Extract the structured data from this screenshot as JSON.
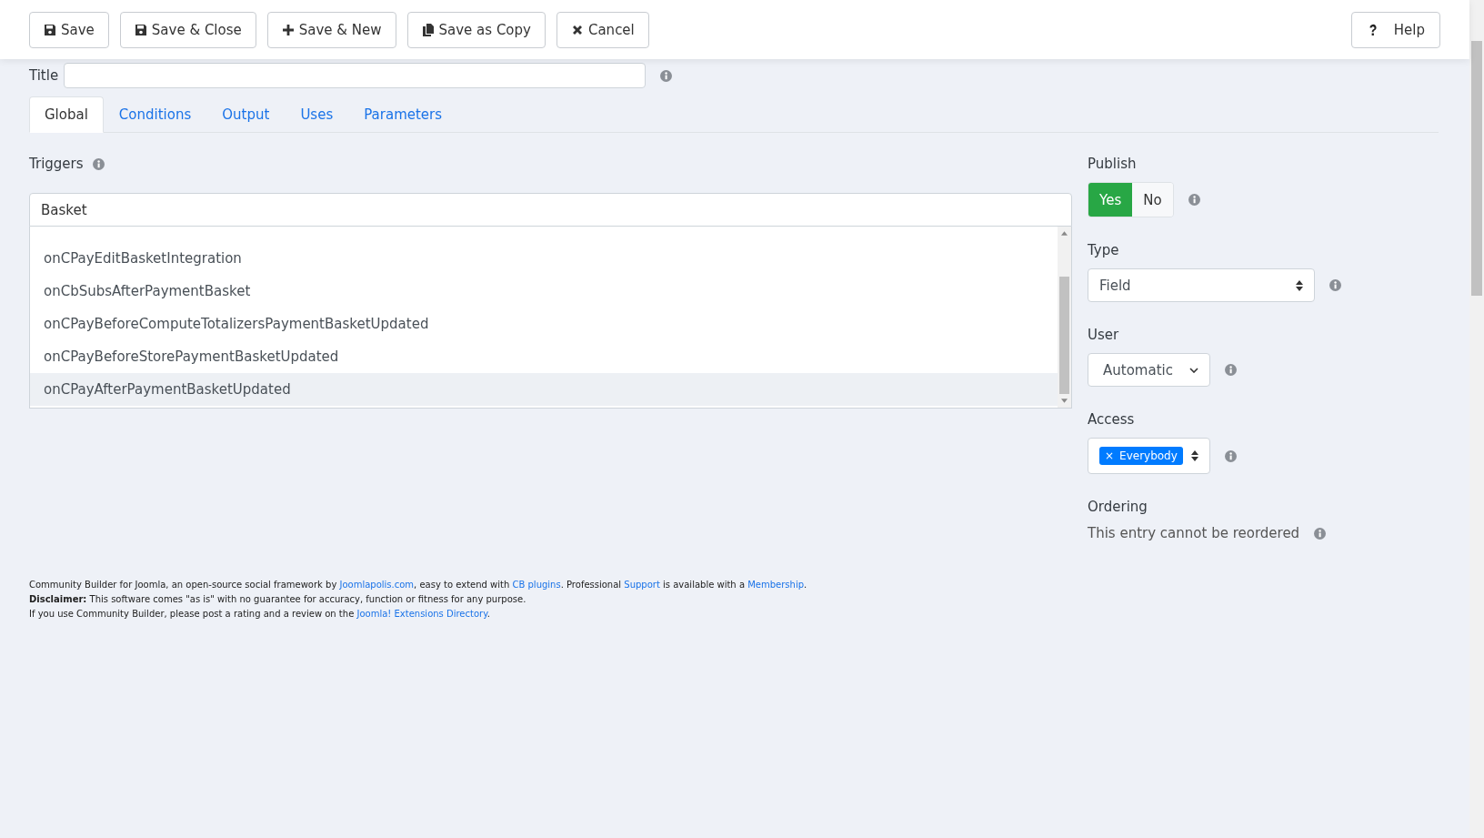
{
  "toolbar": {
    "buttons": [
      {
        "label": "Save"
      },
      {
        "label": "Save & Close"
      },
      {
        "label": "Save & New"
      },
      {
        "label": "Save as Copy"
      },
      {
        "label": "Cancel"
      }
    ],
    "help": {
      "label": "Help"
    }
  },
  "title_field": {
    "label": "Title"
  },
  "tabs": [
    {
      "label": "Global",
      "selected": true
    },
    {
      "label": "Conditions",
      "selected": false
    },
    {
      "label": "Output",
      "selected": false
    },
    {
      "label": "Uses",
      "selected": false
    },
    {
      "label": "Parameters",
      "selected": false
    }
  ],
  "triggers": {
    "label": "Triggers",
    "value": "Basket",
    "options": [
      {
        "label": "onCPayEditBasketIntegration",
        "highlighted": false
      },
      {
        "label": "onCbSubsAfterPaymentBasket",
        "highlighted": false
      },
      {
        "label": "onCPayBeforeComputeTotalizersPaymentBasketUpdated",
        "highlighted": false
      },
      {
        "label": "onCPayBeforeStorePaymentBasketUpdated",
        "highlighted": false
      },
      {
        "label": "onCPayAfterPaymentBasketUpdated",
        "highlighted": true
      }
    ]
  },
  "publish": {
    "label": "Publish",
    "options": [
      {
        "label": "Yes",
        "selected": true
      },
      {
        "label": "No",
        "selected": false
      }
    ]
  },
  "type": {
    "label": "Type",
    "value": "Field"
  },
  "user": {
    "label": "User",
    "value": "Automatic"
  },
  "access": {
    "label": "Access",
    "tags": [
      {
        "remove": "×",
        "label": "Everybody"
      }
    ]
  },
  "ordering": {
    "label": "Ordering",
    "note": "This entry cannot be reordered"
  },
  "footer": [
    [
      {
        "kind": "text",
        "text": "Community Builder for Joomla, an open-source social framework by "
      },
      {
        "kind": "link",
        "text": "Joomlapolis.com"
      },
      {
        "kind": "text",
        "text": ", easy to extend with "
      },
      {
        "kind": "link",
        "text": "CB plugins"
      },
      {
        "kind": "text",
        "text": ". Professional "
      },
      {
        "kind": "link",
        "text": "Support"
      },
      {
        "kind": "text",
        "text": " is available with a "
      },
      {
        "kind": "link",
        "text": "Membership"
      },
      {
        "kind": "text",
        "text": "."
      }
    ],
    [
      {
        "kind": "text",
        "text": "**Disclaimer:** This software comes \"as is\" with no guarantee for accuracy, function or fitness for any purpose."
      }
    ],
    [
      {
        "kind": "text",
        "text": "If you use Community Builder, please post a rating and a review on the "
      },
      {
        "kind": "link",
        "text": "Joomla! Extensions Directory"
      },
      {
        "kind": "text",
        "text": "."
      }
    ]
  ]
}
